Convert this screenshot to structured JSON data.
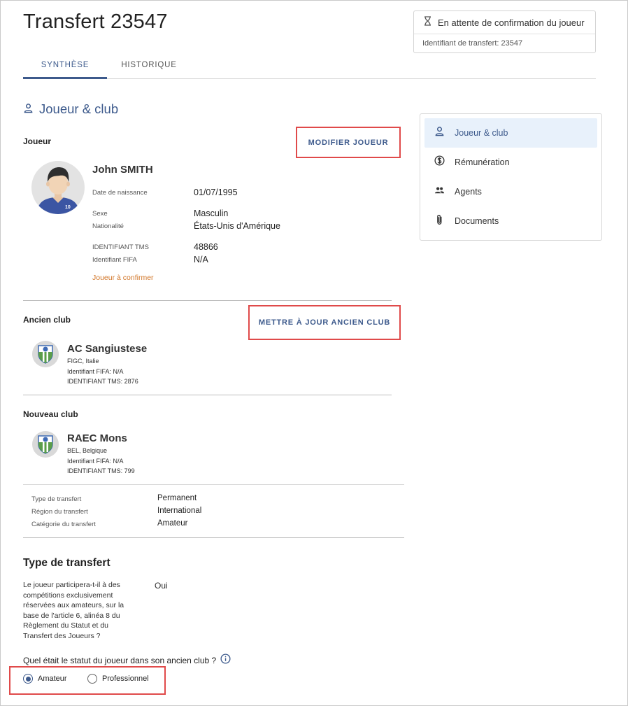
{
  "page": {
    "title": "Transfert 23547"
  },
  "status": {
    "label": "En attente de confirmation du joueur",
    "transfer_id": "Identifiant de transfert: 23547"
  },
  "tabs": [
    {
      "label": "SYNTHÈSE",
      "active": true
    },
    {
      "label": "HISTORIQUE",
      "active": false
    }
  ],
  "section": {
    "title": "Joueur & club"
  },
  "player": {
    "heading": "Joueur",
    "edit_label": "MODIFIER JOUEUR",
    "name": "John SMITH",
    "jersey_number": "10",
    "fields": {
      "birth_label": "Date de naissance",
      "birth_value": "01/07/1995",
      "sex_label": "Sexe",
      "sex_value": "Masculin",
      "nationality_label": "Nationalité",
      "nationality_value": "États-Unis d'Amérique",
      "tms_label": "IDENTIFIANT TMS",
      "tms_value": "48866",
      "fifa_label": "Identifiant FIFA",
      "fifa_value": "N/A"
    },
    "status_text": "Joueur à confirmer"
  },
  "old_club": {
    "heading": "Ancien club",
    "update_label": "METTRE À JOUR ANCIEN CLUB",
    "name": "AC Sangiustese",
    "federation": "FIGC, Italie",
    "fifa": "Identifiant FIFA: N/A",
    "tms": "IDENTIFIANT TMS: 2876"
  },
  "new_club": {
    "heading": "Nouveau club",
    "name": "RAEC Mons",
    "federation": "BEL, Belgique",
    "fifa": "Identifiant FIFA: N/A",
    "tms": "IDENTIFIANT TMS: 799"
  },
  "transfer_info": {
    "type_label": "Type de transfert",
    "type_value": "Permanent",
    "region_label": "Région du transfert",
    "region_value": "International",
    "category_label": "Catégorie du transfert",
    "category_value": "Amateur"
  },
  "transfer_type_section": {
    "title": "Type de transfert",
    "question": "Le joueur participera-t-il à des compétitions exclusivement réservées aux amateurs, sur la base de l'article 6, alinéa 8 du Règlement du Statut et du Transfert des Joueurs ?",
    "question_lines": [
      "Le joueur participera-t-il à des",
      "compétitions exclusivement",
      "réservées aux amateurs, sur la",
      "base de l'article 6, alinéa 8 du",
      "Règlement du Statut et du",
      "Transfert des Joueurs ?"
    ],
    "answer": "Oui",
    "status_question": "Quel était le statut du joueur dans son ancien club ?",
    "options": [
      {
        "label": "Amateur",
        "checked": true
      },
      {
        "label": "Professionnel",
        "checked": false
      }
    ]
  },
  "side_nav": [
    {
      "label": "Joueur & club",
      "icon": "person-icon",
      "active": true
    },
    {
      "label": "Rémunération",
      "icon": "dollar-icon",
      "active": false
    },
    {
      "label": "Agents",
      "icon": "group-icon",
      "active": false
    },
    {
      "label": "Documents",
      "icon": "paperclip-icon",
      "active": false
    }
  ],
  "colors": {
    "accent": "#3d5a8c",
    "highlight": "#e04a4a",
    "warning_text": "#d2772a",
    "nav_active_bg": "#e8f1fb"
  }
}
